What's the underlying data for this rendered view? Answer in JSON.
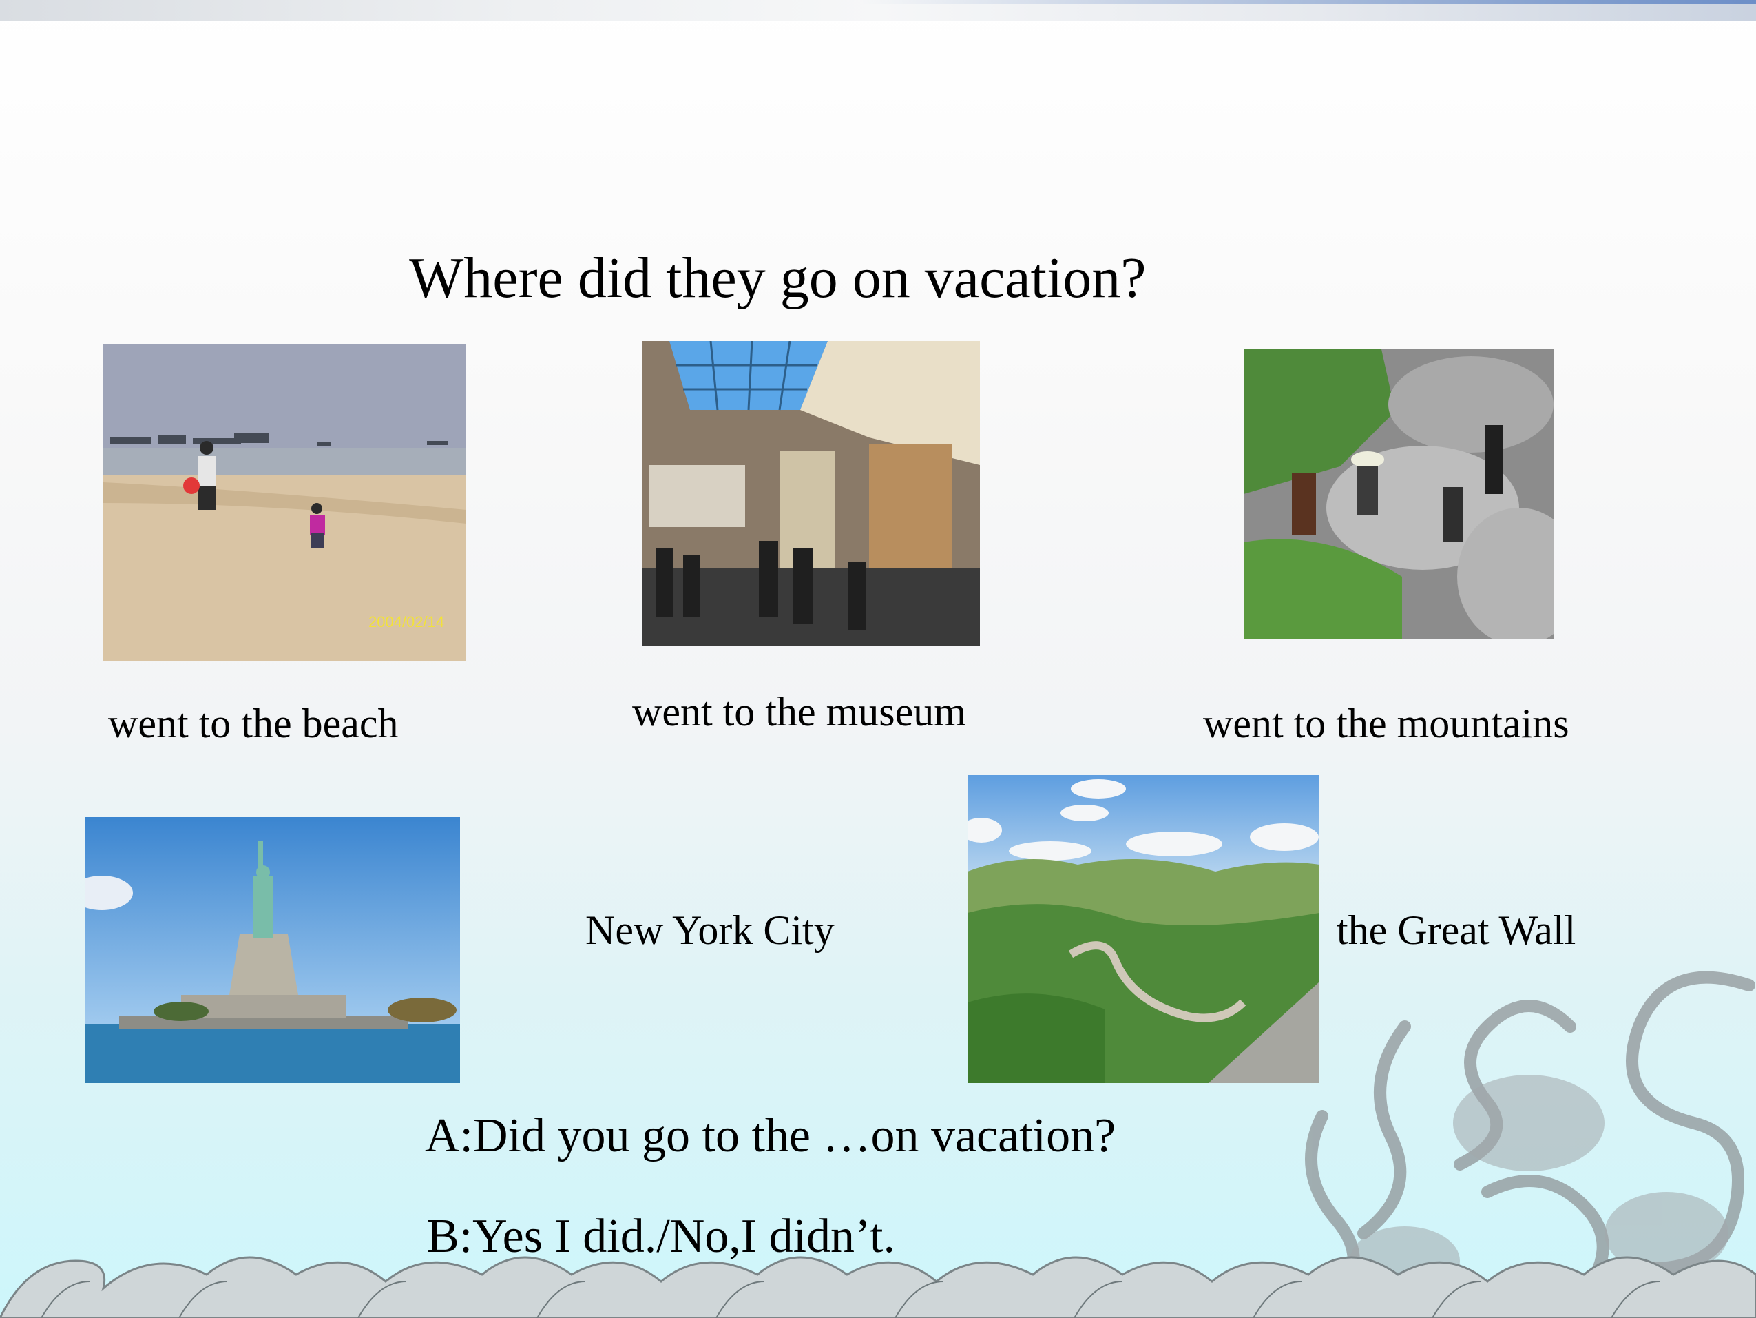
{
  "slide": {
    "title": "Where did they go on vacation?",
    "captions": {
      "beach": "went to the beach",
      "museum": "went to the museum",
      "mountains": "went to the mountains",
      "new_york": "New York City",
      "great_wall": "the Great Wall"
    },
    "photo_stamps": {
      "beach_date": "2004/02/14"
    },
    "dialog": {
      "question": "A:Did you go to the  …on vacation?",
      "answer": "B:Yes I did./No,I didn’t."
    }
  },
  "colors": {
    "sky_blue": "#4a8fd3",
    "sea_blue": "#2f7fb3",
    "mountain_green": "#4f8a3a",
    "sand": "#d8c2a0",
    "text": "#000000"
  }
}
